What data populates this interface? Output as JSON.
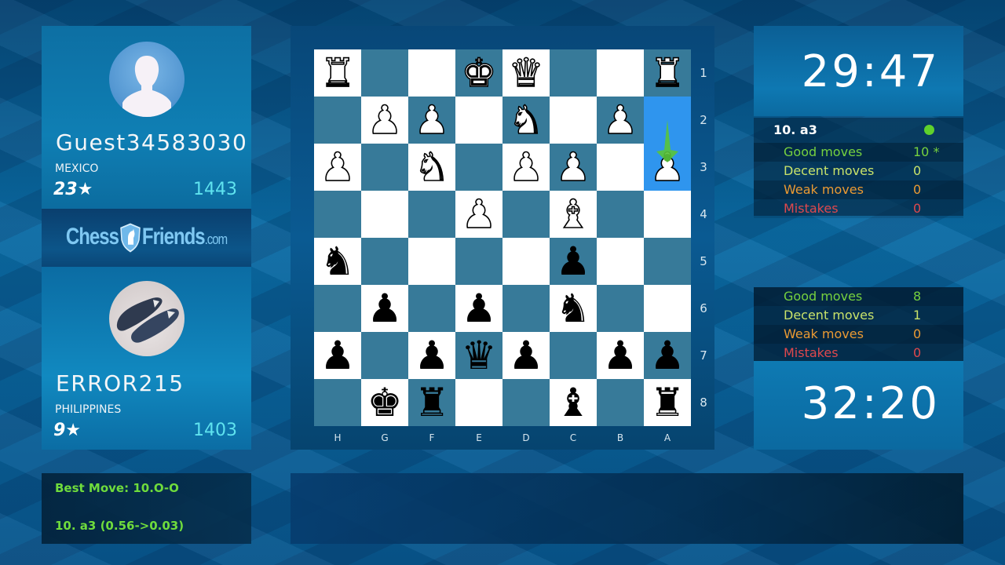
{
  "players": {
    "top": {
      "name": "Guest34583030",
      "country": "MEXICO",
      "stars": "23★",
      "rating": "1443",
      "avatar": "silhouette-avatar"
    },
    "bottom": {
      "name": "ERROR215",
      "country": "PHILIPPINES",
      "stars": "9★",
      "rating": "1403",
      "avatar": "shoes-photo-avatar"
    }
  },
  "logo": {
    "part1": "Chess",
    "part2": "Friends",
    "suffix": ".com"
  },
  "analysis": {
    "best_move": "Best Move: 10.O-O",
    "eval_line": "10. a3 (0.56->0.03)"
  },
  "clocks": {
    "top": "29:47",
    "bottom": "32:20"
  },
  "stats_top": {
    "last_move": "10. a3",
    "indicator_color": "#5fd12c",
    "rows": [
      {
        "label": "Good moves",
        "value": "10 *"
      },
      {
        "label": "Decent moves",
        "value": "0"
      },
      {
        "label": "Weak moves",
        "value": "0"
      },
      {
        "label": "Mistakes",
        "value": "0"
      }
    ]
  },
  "stats_bottom": {
    "rows": [
      {
        "label": "Good moves",
        "value": "8"
      },
      {
        "label": "Decent moves",
        "value": "1"
      },
      {
        "label": "Weak moves",
        "value": "0"
      },
      {
        "label": "Mistakes",
        "value": "0"
      }
    ]
  },
  "board": {
    "files": [
      "H",
      "G",
      "F",
      "E",
      "D",
      "C",
      "B",
      "A"
    ],
    "ranks": [
      "1",
      "2",
      "3",
      "4",
      "5",
      "6",
      "7",
      "8"
    ],
    "highlighted": [
      "a2",
      "a3"
    ],
    "last_move_arrow": {
      "from": "a2",
      "to": "a3",
      "color": "#5ac43a"
    },
    "colors": {
      "light": "#ffffff",
      "dark": "#377a99",
      "highlight": "#2f95ee"
    },
    "rows": [
      [
        "wR",
        "",
        "",
        "wK",
        "wQ",
        "",
        "",
        "wR"
      ],
      [
        "",
        "wP",
        "wP",
        "",
        "wN",
        "",
        "wP",
        ""
      ],
      [
        "wP",
        "",
        "wN",
        "",
        "wP",
        "wP",
        "",
        "wP"
      ],
      [
        "",
        "",
        "",
        "wP",
        "",
        "wB",
        "",
        ""
      ],
      [
        "bN",
        "",
        "",
        "",
        "",
        "bP",
        "",
        ""
      ],
      [
        "",
        "bP",
        "",
        "bP",
        "",
        "bN",
        "",
        ""
      ],
      [
        "bP",
        "",
        "bP",
        "bQ",
        "bP",
        "",
        "bP",
        "bP"
      ],
      [
        "",
        "bK",
        "bR",
        "",
        "",
        "bB",
        "",
        "bR"
      ]
    ]
  }
}
